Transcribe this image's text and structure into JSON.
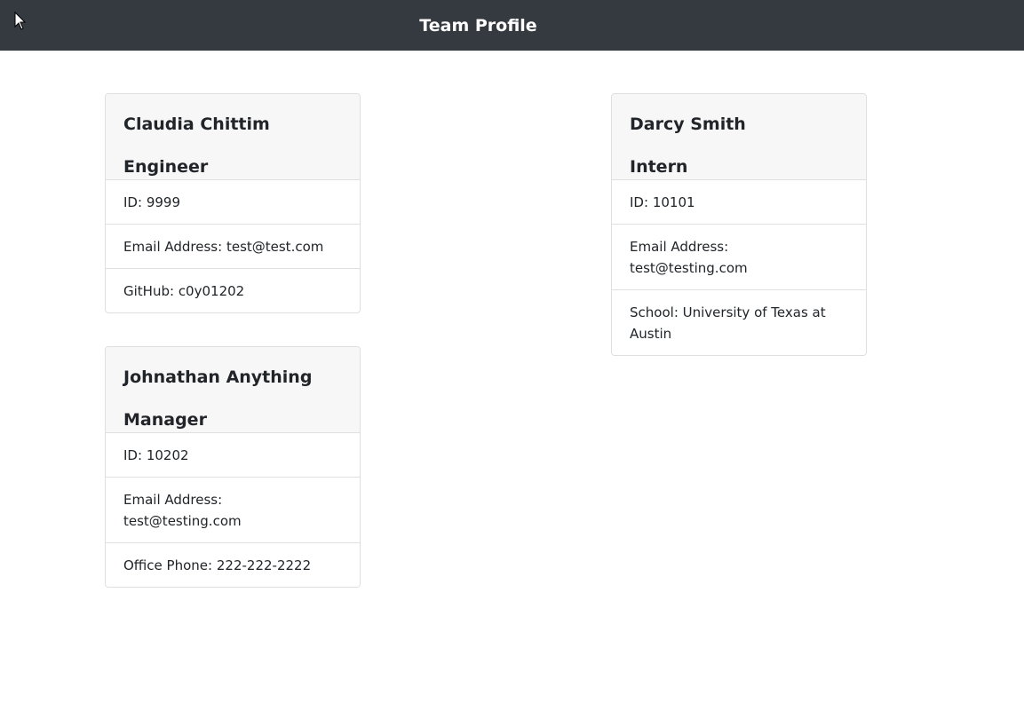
{
  "header": {
    "title": "Team Profile"
  },
  "cards": [
    {
      "name": "Claudia Chittim",
      "role": "Engineer",
      "items": [
        {
          "label": "ID",
          "value": "9999"
        },
        {
          "label": "Email Address",
          "value": "test@test.com"
        },
        {
          "label": "GitHub",
          "value": "c0y01202"
        }
      ]
    },
    {
      "name": "Darcy Smith",
      "role": "Intern",
      "items": [
        {
          "label": "ID",
          "value": "10101"
        },
        {
          "label": "Email Address",
          "value": "test@testing.com"
        },
        {
          "label": "School",
          "value": "University of Texas at Austin"
        }
      ]
    },
    {
      "name": "Johnathan Anything",
      "role": "Manager",
      "items": [
        {
          "label": "ID",
          "value": "10202"
        },
        {
          "label": "Email Address",
          "value": "test@testing.com"
        },
        {
          "label": "Office Phone",
          "value": "222-222-2222"
        }
      ]
    }
  ]
}
